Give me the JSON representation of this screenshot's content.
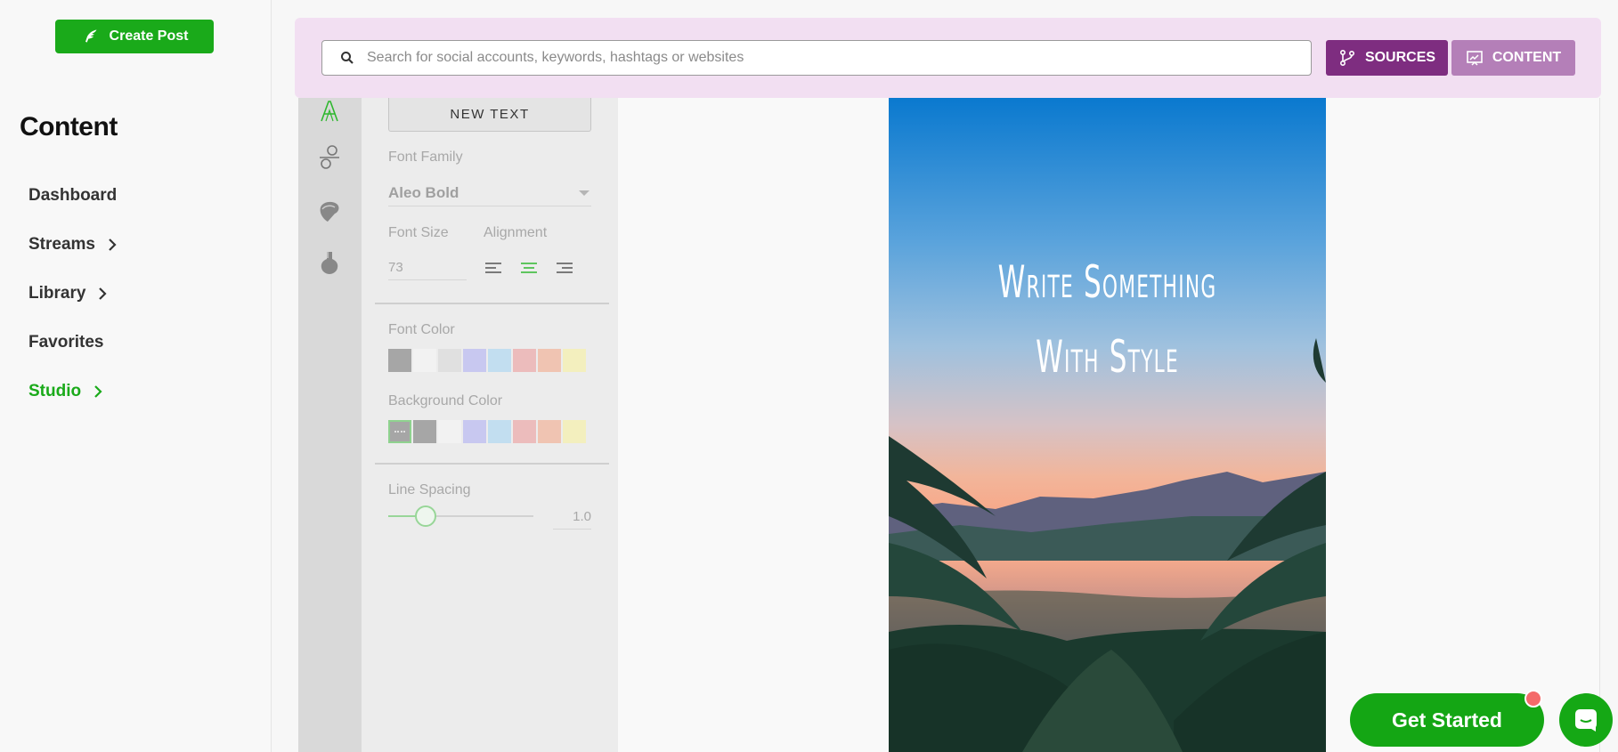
{
  "sidebar": {
    "create_post_label": "Create Post",
    "title": "Content",
    "items": [
      {
        "label": "Dashboard",
        "has_chevron": false,
        "active": false
      },
      {
        "label": "Streams",
        "has_chevron": true,
        "active": false
      },
      {
        "label": "Library",
        "has_chevron": true,
        "active": false
      },
      {
        "label": "Favorites",
        "has_chevron": false,
        "active": false
      },
      {
        "label": "Studio",
        "has_chevron": true,
        "active": true
      }
    ]
  },
  "search": {
    "placeholder": "Search for social accounts, keywords, hashtags or websites",
    "value": ""
  },
  "header_buttons": {
    "sources_label": "SOURCES",
    "content_label": "CONTENT"
  },
  "tools": [
    "text-tool-icon",
    "filter-tool-icon",
    "sticker-tool-icon",
    "effects-tool-icon"
  ],
  "panel": {
    "new_text_label": "NEW TEXT",
    "font_family_label": "Font Family",
    "font_family_value": "Aleo Bold",
    "font_size_label": "Font Size",
    "font_size_value": "73",
    "alignment_label": "Alignment",
    "alignment_selected": "center",
    "font_color_label": "Font Color",
    "font_colors": [
      "#a6a6a6",
      "#f2f2f2",
      "#e0e0e0",
      "#c8c8f0",
      "#c2def0",
      "#ecbcbc",
      "#f0c4b2",
      "#f3efbe"
    ],
    "background_color_label": "Background Color",
    "background_colors": [
      "transparent",
      "#a6a6a6",
      "#f2f2f2",
      "#c8c8f0",
      "#c2def0",
      "#ecbcbc",
      "#f0c4b2",
      "#f3efbe"
    ],
    "line_spacing_label": "Line Spacing",
    "line_spacing_value": "1.0"
  },
  "canvas": {
    "text": "Write Something\nWith Style"
  },
  "cta": {
    "get_started_label": "Get Started"
  },
  "colors": {
    "brand_green": "#1aaa1a",
    "sources_purple": "#7e2d80",
    "content_purple": "#b47fb8",
    "search_bg": "#f2dff2"
  }
}
